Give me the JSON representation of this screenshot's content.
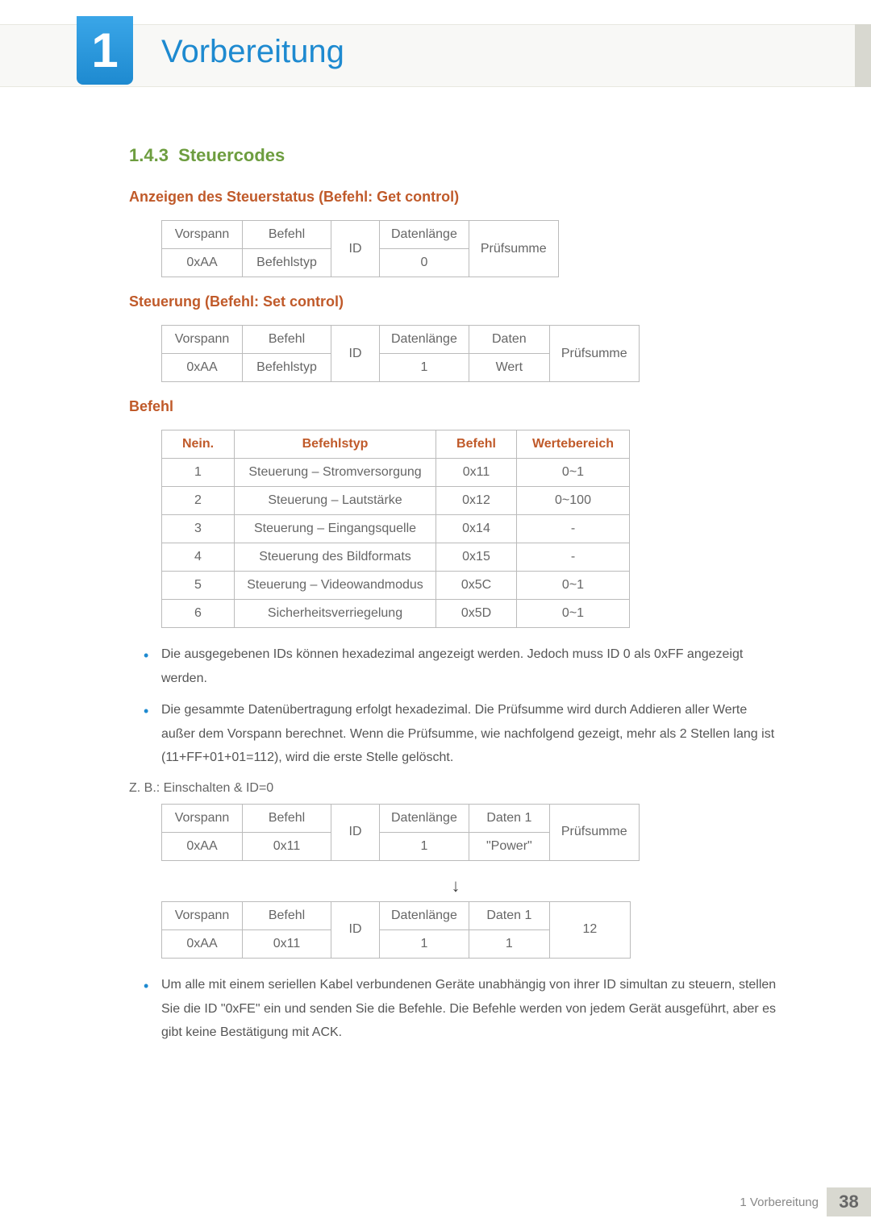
{
  "chapter": {
    "number": "1",
    "title": "Vorbereitung"
  },
  "section": {
    "number": "1.4.3",
    "title": "Steuercodes"
  },
  "sub1": "Anzeigen des Steuerstatus (Befehl: Get control)",
  "table1": {
    "r1": {
      "c1": "Vorspann",
      "c2": "Befehl",
      "c3": "ID",
      "c4": "Datenlänge",
      "c5": "Prüfsumme"
    },
    "r2": {
      "c1": "0xAA",
      "c2": "Befehlstyp",
      "c4": "0"
    }
  },
  "sub2": "Steuerung (Befehl: Set control)",
  "table2": {
    "r1": {
      "c1": "Vorspann",
      "c2": "Befehl",
      "c3": "ID",
      "c4": "Datenlänge",
      "c5": "Daten",
      "c6": "Prüfsumme"
    },
    "r2": {
      "c1": "0xAA",
      "c2": "Befehlstyp",
      "c4": "1",
      "c5": "Wert"
    }
  },
  "sub3": "Befehl",
  "cmdlist": {
    "head": {
      "c1": "Nein.",
      "c2": "Befehlstyp",
      "c3": "Befehl",
      "c4": "Wertebereich"
    },
    "rows": [
      {
        "n": "1",
        "t": "Steuerung – Stromversorgung",
        "b": "0x11",
        "r": "0~1"
      },
      {
        "n": "2",
        "t": "Steuerung – Lautstärke",
        "b": "0x12",
        "r": "0~100"
      },
      {
        "n": "3",
        "t": "Steuerung – Eingangsquelle",
        "b": "0x14",
        "r": "-"
      },
      {
        "n": "4",
        "t": "Steuerung des Bildformats",
        "b": "0x15",
        "r": "-"
      },
      {
        "n": "5",
        "t": "Steuerung – Videowandmodus",
        "b": "0x5C",
        "r": "0~1"
      },
      {
        "n": "6",
        "t": "Sicherheitsverriegelung",
        "b": "0x5D",
        "r": "0~1"
      }
    ]
  },
  "bullets1": [
    "Die ausgegebenen IDs können hexadezimal angezeigt werden. Jedoch muss ID 0 als 0xFF angezeigt werden.",
    "Die gesammte Datenübertragung erfolgt hexadezimal. Die Prüfsumme wird durch Addieren aller Werte außer dem Vorspann berechnet. Wenn die Prüfsumme, wie nachfolgend gezeigt, mehr als 2 Stellen lang ist (11+FF+01+01=112), wird die erste Stelle gelöscht."
  ],
  "example_label": "Z. B.: Einschalten & ID=0",
  "table3": {
    "r1": {
      "c1": "Vorspann",
      "c2": "Befehl",
      "c3": "ID",
      "c4": "Datenlänge",
      "c5": "Daten 1",
      "c6": "Prüfsumme"
    },
    "r2": {
      "c1": "0xAA",
      "c2": "0x11",
      "c4": "1",
      "c5": "\"Power\""
    }
  },
  "arrow": "↓",
  "table4": {
    "r1": {
      "c1": "Vorspann",
      "c2": "Befehl",
      "c3": "ID",
      "c4": "Datenlänge",
      "c5": "Daten 1",
      "c6": "12"
    },
    "r2": {
      "c1": "0xAA",
      "c2": "0x11",
      "c4": "1",
      "c5": "1"
    }
  },
  "bullets2": [
    "Um alle mit einem seriellen Kabel verbundenen Geräte unabhängig von ihrer ID simultan zu steuern, stellen Sie die ID \"0xFE\" ein und senden Sie die Befehle. Die Befehle werden von jedem Gerät ausgeführt, aber es gibt keine Bestätigung mit ACK."
  ],
  "footer": {
    "text": "1 Vorbereitung",
    "page": "38"
  }
}
